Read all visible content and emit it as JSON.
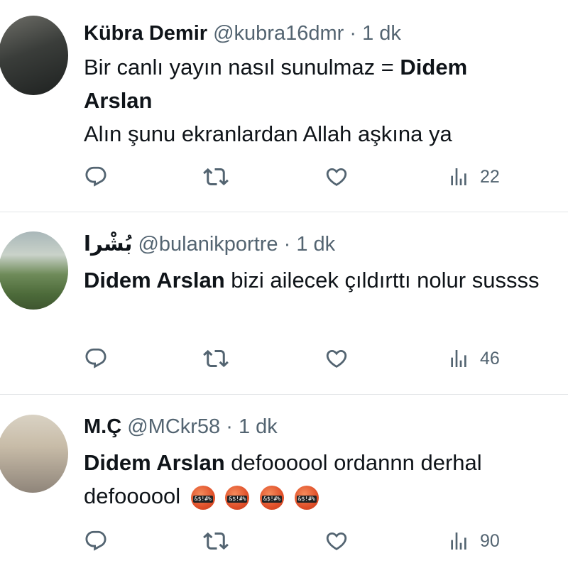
{
  "tweets": [
    {
      "name": "Kübra Demir",
      "handle": "@kubra16dmr",
      "time": "1 dk",
      "line1_prefix": "Bir canlı yayın nasıl sunulmaz = ",
      "line1_bold": "Didem Arslan",
      "line2": "Alın şunu ekranlardan Allah aşkına ya",
      "views": "22"
    },
    {
      "name": "بُشْرا",
      "handle": "@bulanikportre",
      "time": "1 dk",
      "bold": "Didem Arslan",
      "text": " bizi ailecek çıldırttı nolur sussss",
      "views": "46"
    },
    {
      "name": "M.Ç",
      "handle": "@MCkr58",
      "time": "1 dk",
      "bold": "Didem Arslan",
      "text": "  defoooool ordannn derhal defoooool",
      "views": "90"
    }
  ],
  "separator": " · ",
  "icons": [
    "reply-icon",
    "retweet-icon",
    "like-icon",
    "views-icon",
    "enraged-face-emoji"
  ],
  "colors": {
    "text": "#0f1419",
    "secondary": "#536471",
    "divider": "#e3e6e8"
  }
}
